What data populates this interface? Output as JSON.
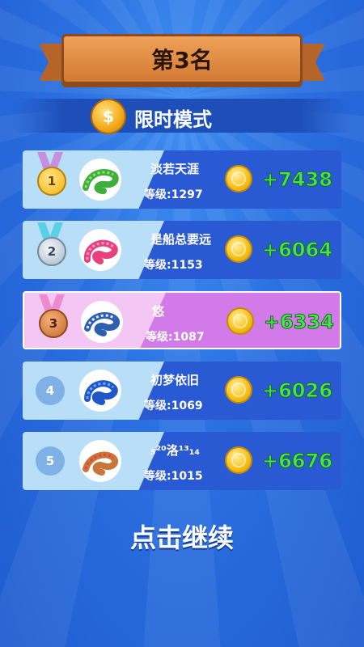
{
  "header": {
    "title": "第3名"
  },
  "mode": {
    "label": "限时模式",
    "icon": "dollar-coin-icon",
    "coin_symbol": "$"
  },
  "rows": [
    {
      "rank": "1",
      "badge": "gold-medal-icon",
      "name": "淡若天涯",
      "level": "等级:1297",
      "reward": "+7438",
      "snake": "green-snake-icon",
      "highlight": false
    },
    {
      "rank": "2",
      "badge": "silver-medal-icon",
      "name": "是船总要远",
      "level": "等级:1153",
      "reward": "+6064",
      "snake": "pink-snake-icon",
      "highlight": false
    },
    {
      "rank": "3",
      "badge": "bronze-medal-icon",
      "name": "悠",
      "level": "等级:1087",
      "reward": "+6334",
      "snake": "blue-white-snake-icon",
      "highlight": true
    },
    {
      "rank": "4",
      "badge": "rank-circle",
      "name": "初梦依旧",
      "level": "等级:1069",
      "reward": "+6026",
      "snake": "blue-snake-icon",
      "highlight": false
    },
    {
      "rank": "5",
      "badge": "rank-circle",
      "name": "₅²⁰洛¹³₁₄",
      "level": "等级:1015",
      "reward": "+6676",
      "snake": "orange-snake-icon",
      "highlight": false
    }
  ],
  "footer": {
    "continue_label": "点击继续"
  },
  "colors": {
    "gold": "#f5c12a",
    "silver": "#c9d6e6",
    "bronze": "#d98a4a",
    "reward_green": "#47e64f",
    "highlight": "#d27ae8"
  }
}
